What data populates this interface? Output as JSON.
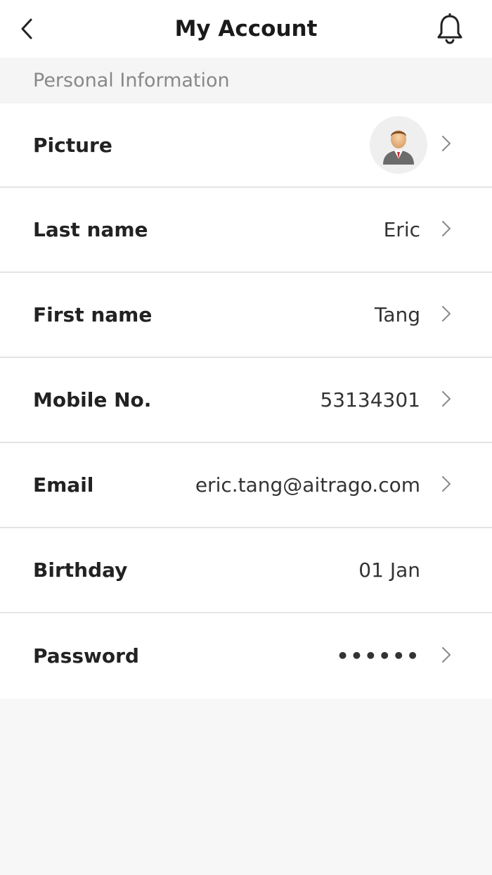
{
  "header": {
    "title": "My Account",
    "back_icon": "chevron-left-icon",
    "bell_icon": "bell-icon"
  },
  "section": {
    "title": "Personal Information"
  },
  "rows": [
    {
      "label": "Picture",
      "value": "",
      "chevron": true
    },
    {
      "label": "Last name",
      "value": "Eric",
      "chevron": true
    },
    {
      "label": "First name",
      "value": "Tang",
      "chevron": true
    },
    {
      "label": "Mobile No.",
      "value": "53134301",
      "chevron": true
    },
    {
      "label": "Email",
      "value": "eric.tang@aitrago.com",
      "chevron": true
    },
    {
      "label": "Birthday",
      "value": "01 Jan",
      "chevron": false
    },
    {
      "label": "Password",
      "value": "••••••",
      "chevron": true
    }
  ],
  "colors": {
    "page_bg": "#f7f7f7",
    "section_text": "#888888",
    "divider": "#e4e4e4"
  }
}
